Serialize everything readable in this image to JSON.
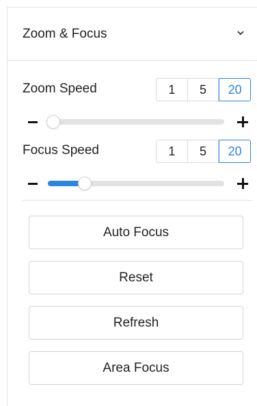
{
  "panel": {
    "title": "Zoom & Focus",
    "collapse_icon": "chevron-down-icon"
  },
  "zoom": {
    "label": "Zoom Speed",
    "options": [
      "1",
      "5",
      "20"
    ],
    "selected": "20",
    "slider_value": 0.03,
    "decrease_icon": "minus-icon",
    "increase_icon": "plus-icon"
  },
  "focus": {
    "label": "Focus Speed",
    "options": [
      "1",
      "5",
      "20"
    ],
    "selected": "20",
    "slider_value": 0.21,
    "decrease_icon": "minus-icon",
    "increase_icon": "plus-icon"
  },
  "buttons": {
    "auto_focus": "Auto Focus",
    "reset": "Reset",
    "refresh": "Refresh",
    "area_focus": "Area Focus"
  },
  "colors": {
    "accent": "#2b85e4",
    "track": "#e2e2e2"
  }
}
